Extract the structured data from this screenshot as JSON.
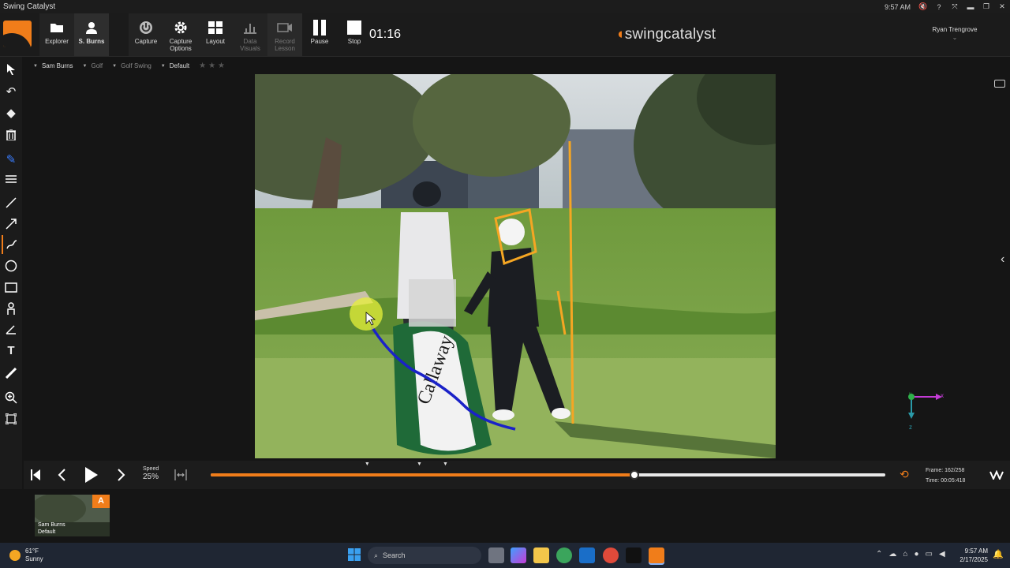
{
  "window": {
    "title": "Swing Catalyst",
    "clock": "9:57 AM"
  },
  "toolbar": {
    "explorer": "Explorer",
    "user_button": "S. Burns",
    "capture": "Capture",
    "capture_options": "Capture Options",
    "layout": "Layout",
    "data_visuals": "Data Visuals",
    "record_lesson": "Record Lesson",
    "pause": "Pause",
    "stop": "Stop",
    "timer": "01:16",
    "brand_part1": "swing",
    "brand_part2": "catalyst",
    "user_name": "Ryan Trengrove"
  },
  "breadcrumb": [
    "Sam Burns",
    "Golf",
    "Golf Swing",
    "Default"
  ],
  "axis": {
    "x": "x",
    "y": "y",
    "z": "z"
  },
  "playback": {
    "speed_label": "Speed",
    "speed_value": "25%",
    "frame_label": "Frame:",
    "frame_value": "162/258",
    "time_label": "Time:",
    "time_value": "00:05:418",
    "current_frame": 162,
    "total_frames": 258,
    "markers_fraction": [
      0.2315,
      0.3088,
      0.3474
    ]
  },
  "thumbnail": {
    "badge": "A",
    "name": "Sam Burns",
    "sub": "Default"
  },
  "taskbar": {
    "weather_temp": "61°F",
    "weather_desc": "Sunny",
    "search_placeholder": "Search",
    "time": "9:57 AM",
    "date": "2/17/2025"
  },
  "colors": {
    "accent": "#f07d1a",
    "annotation_orange": "#f5a623",
    "trace_blue": "#1a22c8"
  }
}
